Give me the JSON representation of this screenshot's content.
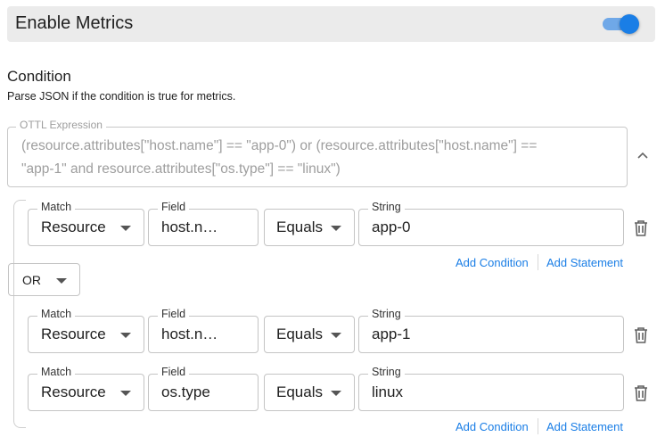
{
  "header": {
    "title": "Enable Metrics",
    "toggle_on": true,
    "accent": "#1a7ee6"
  },
  "condition": {
    "title": "Condition",
    "description": "Parse JSON if the condition is true for metrics."
  },
  "ottl": {
    "label": "OTTL Expression",
    "line1": "(resource.attributes[\"host.name\"] == \"app-0\") or (resource.attributes[\"host.name\"] ==",
    "line2": "\"app-1\" and resource.attributes[\"os.type\"] == \"linux\")",
    "collapse_icon": "chevron-up-icon"
  },
  "labels": {
    "match": "Match",
    "field": "Field",
    "string": "String"
  },
  "groups": [
    {
      "rows": [
        {
          "match": "Resource",
          "field": "host.n…",
          "operator": "Equals",
          "value": "app-0"
        }
      ],
      "add_condition": "Add Condition",
      "add_statement": "Add Statement"
    },
    {
      "rows": [
        {
          "match": "Resource",
          "field": "host.n…",
          "operator": "Equals",
          "value": "app-1"
        },
        {
          "match": "Resource",
          "field": "os.type",
          "operator": "Equals",
          "value": "linux"
        }
      ],
      "add_condition": "Add Condition",
      "add_statement": "Add Statement"
    }
  ],
  "connector": {
    "value": "OR"
  }
}
